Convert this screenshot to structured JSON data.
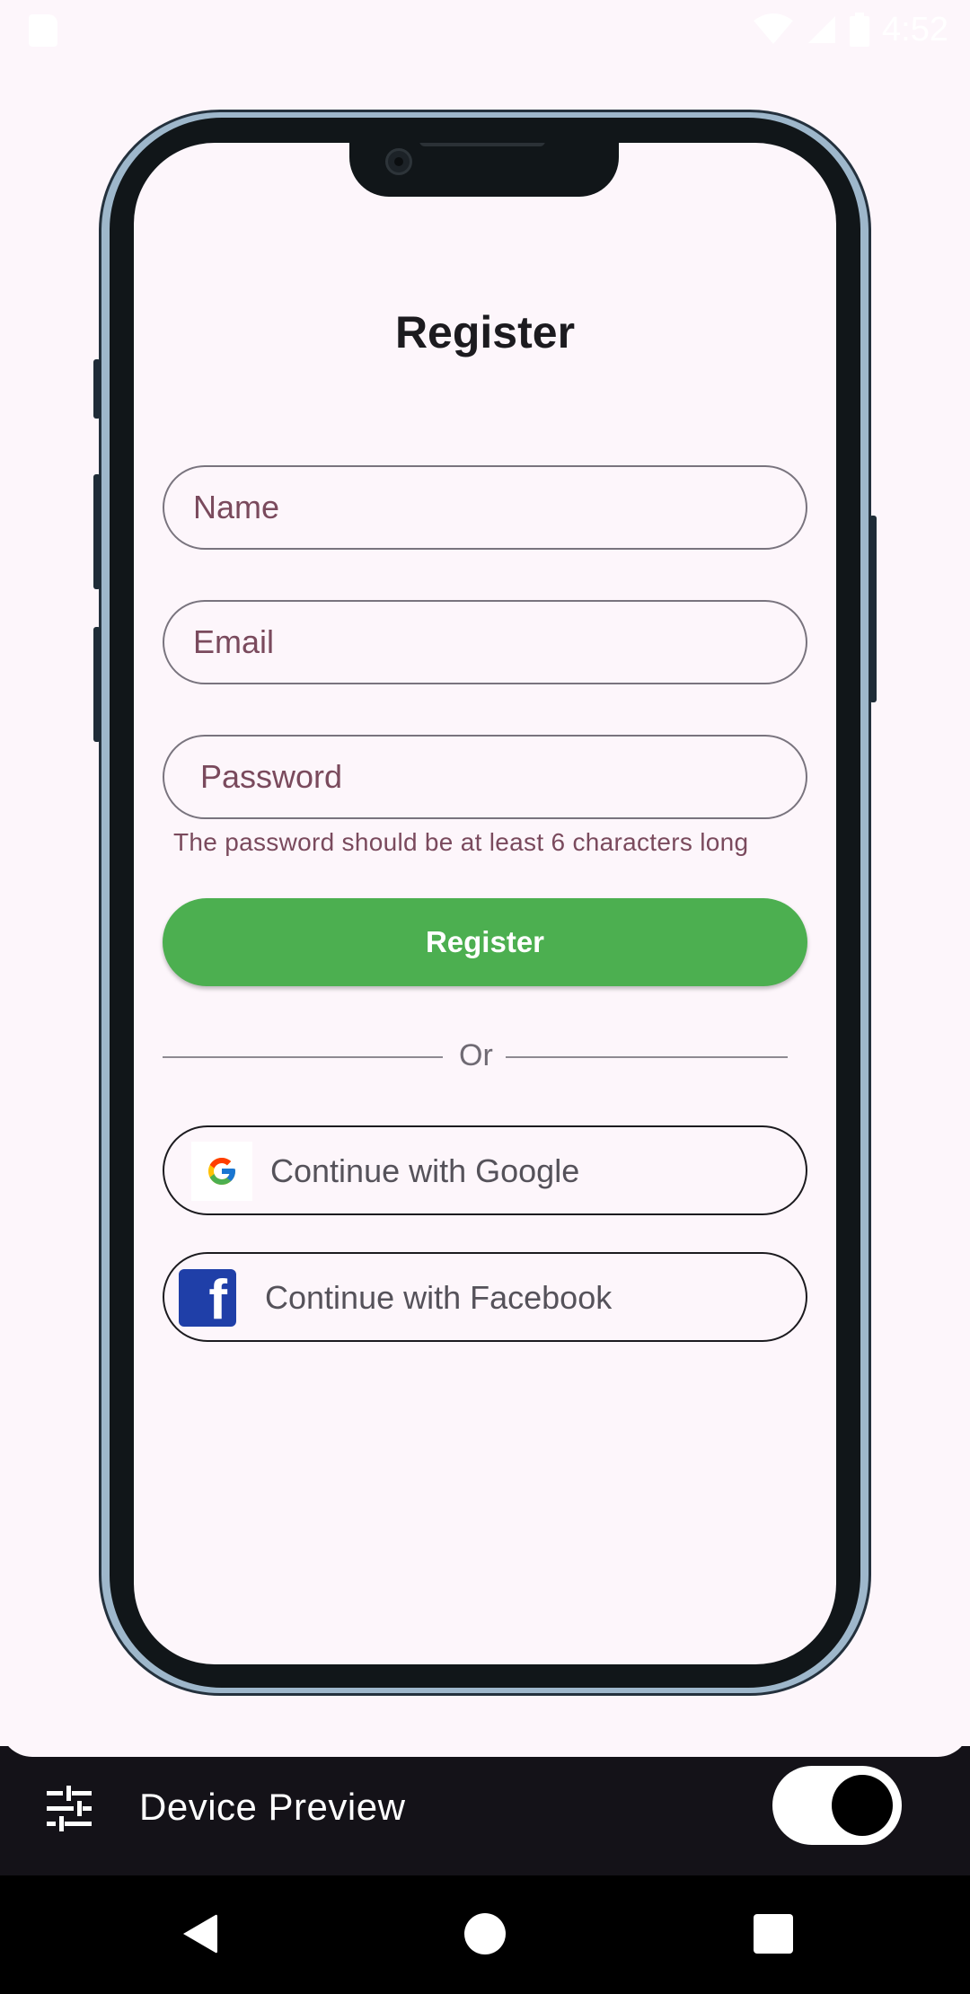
{
  "status_bar": {
    "time": "4:52"
  },
  "register": {
    "title": "Register",
    "name_placeholder": "Name",
    "email_placeholder": "Email",
    "password_placeholder": "Password",
    "password_helper": "The password should be at least 6 characters long",
    "register_button": "Register",
    "or_text": "Or",
    "google_button": "Continue with Google",
    "facebook_button": "Continue with Facebook"
  },
  "device_preview": {
    "label": "Device Preview",
    "toggle_on": true
  },
  "colors": {
    "accent_green": "#4caf50",
    "facebook_blue": "#1f3fa8",
    "background": "#fdf6fb"
  }
}
